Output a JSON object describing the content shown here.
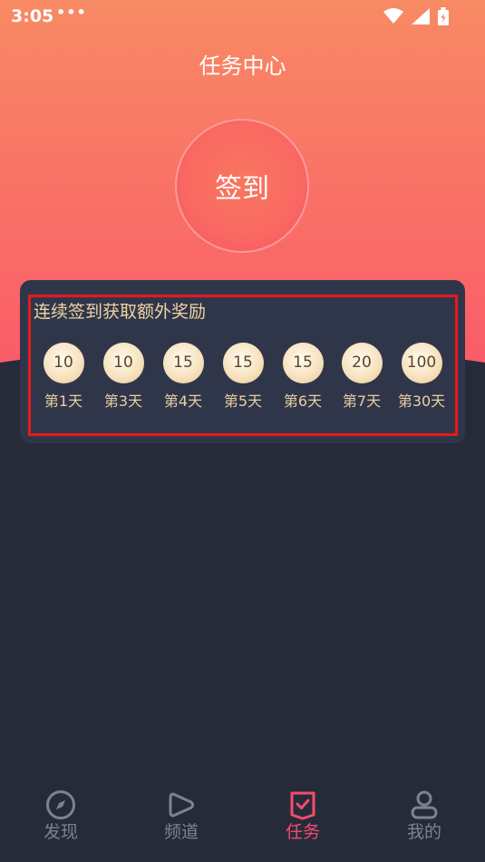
{
  "status_bar": {
    "time": "3:05",
    "dots": "•••"
  },
  "header": {
    "title": "任务中心"
  },
  "signin": {
    "label": "签到"
  },
  "rewards": {
    "title": "连续签到获取额外奖励",
    "items": [
      {
        "points": "10",
        "day": "第1天"
      },
      {
        "points": "10",
        "day": "第3天"
      },
      {
        "points": "15",
        "day": "第4天"
      },
      {
        "points": "15",
        "day": "第5天"
      },
      {
        "points": "15",
        "day": "第6天"
      },
      {
        "points": "20",
        "day": "第7天"
      },
      {
        "points": "100",
        "day": "第30天"
      }
    ]
  },
  "tabs": [
    {
      "label": "发现",
      "icon": "compass-icon"
    },
    {
      "label": "频道",
      "icon": "play-icon"
    },
    {
      "label": "任务",
      "icon": "task-check-icon",
      "active": true
    },
    {
      "label": "我的",
      "icon": "user-icon"
    }
  ],
  "colors": {
    "accent": "#f44c6e",
    "gold": "#efd3a4",
    "background": "#262b3a"
  }
}
